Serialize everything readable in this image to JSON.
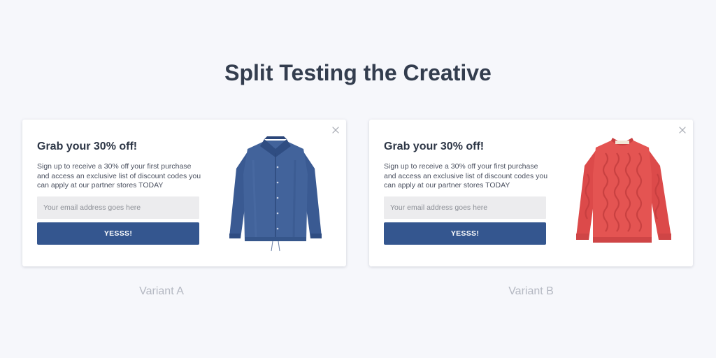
{
  "page": {
    "title": "Split Testing the Creative"
  },
  "colors": {
    "background": "#f6f7fb",
    "button": "#34568f",
    "input_bg": "#ececee",
    "jacket": "#3f5f97",
    "sweater": "#e35452"
  },
  "variants": [
    {
      "label": "Variant A",
      "popup": {
        "heading": "Grab your 30% off!",
        "description": "Sign up to receive a 30% off your first purchase and access an exclusive list of discount codes you can apply at our partner stores TODAY",
        "email_placeholder": "Your email address goes here",
        "email_value": "",
        "button_label": "YESSS!",
        "close_icon": "close-icon",
        "product": "denim-jacket-image"
      }
    },
    {
      "label": "Variant B",
      "popup": {
        "heading": "Grab your 30% off!",
        "description": "Sign up to receive a 30% off your first purchase and access an exclusive list of discount codes you can apply at our partner stores TODAY",
        "email_placeholder": "Your email address goes here",
        "email_value": "",
        "button_label": "YESSS!",
        "close_icon": "close-icon",
        "product": "red-sweater-image"
      }
    }
  ]
}
